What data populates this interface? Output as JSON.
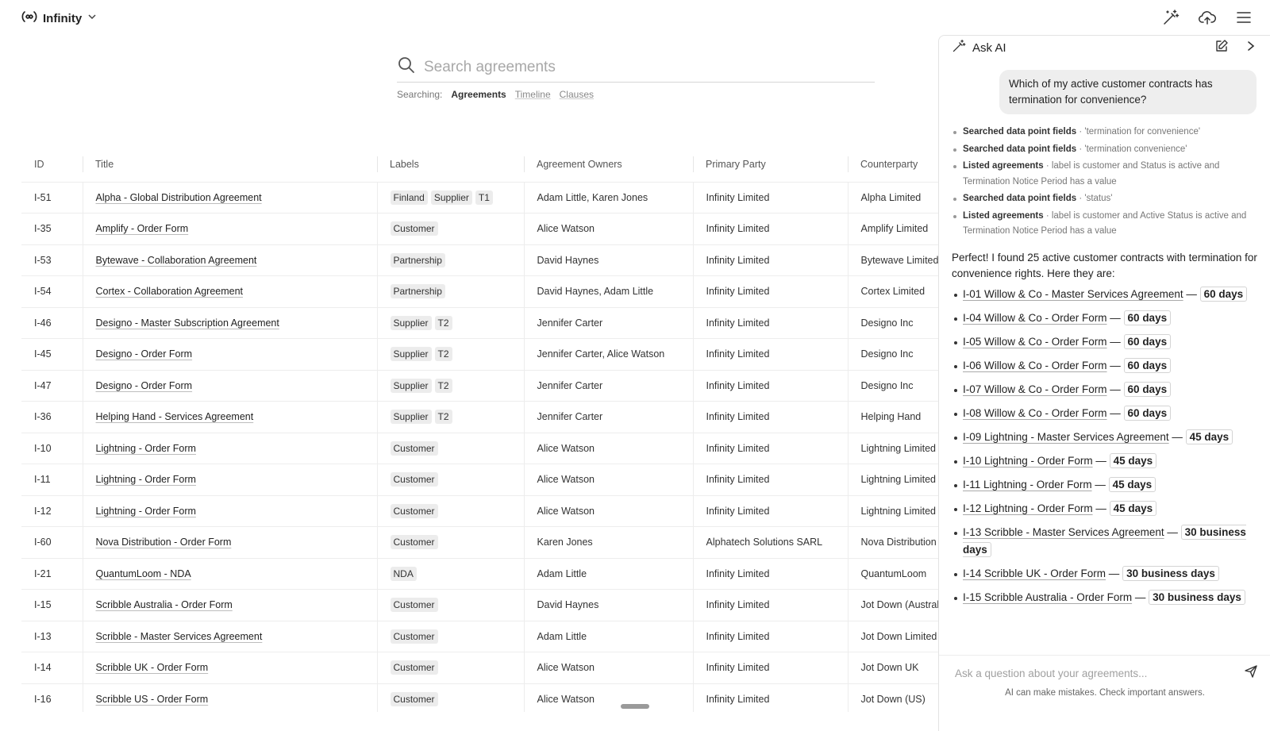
{
  "app": {
    "name": "Infinity"
  },
  "search": {
    "placeholder": "Search agreements",
    "searching_label": "Searching:",
    "scopes": [
      "Agreements",
      "Timeline",
      "Clauses"
    ]
  },
  "table": {
    "columns": [
      "ID",
      "Title",
      "Labels",
      "Agreement Owners",
      "Primary Party",
      "Counterparty"
    ],
    "rows": [
      {
        "id": "I-51",
        "title": "Alpha - Global Distribution Agreement",
        "labels": [
          "Finland",
          "Supplier",
          "T1"
        ],
        "owners": "Adam Little, Karen Jones",
        "primary": "Infinity Limited",
        "counterparty": "Alpha Limited"
      },
      {
        "id": "I-35",
        "title": "Amplify - Order Form",
        "labels": [
          "Customer"
        ],
        "owners": "Alice Watson",
        "primary": "Infinity Limited",
        "counterparty": "Amplify Limited"
      },
      {
        "id": "I-53",
        "title": "Bytewave - Collaboration Agreement",
        "labels": [
          "Partnership"
        ],
        "owners": "David Haynes",
        "primary": "Infinity Limited",
        "counterparty": "Bytewave Limited"
      },
      {
        "id": "I-54",
        "title": "Cortex - Collaboration Agreement",
        "labels": [
          "Partnership"
        ],
        "owners": "David Haynes, Adam Little",
        "primary": "Infinity Limited",
        "counterparty": "Cortex Limited"
      },
      {
        "id": "I-46",
        "title": "Designo - Master Subscription Agreement",
        "labels": [
          "Supplier",
          "T2"
        ],
        "owners": "Jennifer Carter",
        "primary": "Infinity Limited",
        "counterparty": "Designo Inc"
      },
      {
        "id": "I-45",
        "title": "Designo - Order Form",
        "labels": [
          "Supplier",
          "T2"
        ],
        "owners": "Jennifer Carter, Alice Watson",
        "primary": "Infinity Limited",
        "counterparty": "Designo Inc"
      },
      {
        "id": "I-47",
        "title": "Designo - Order Form",
        "labels": [
          "Supplier",
          "T2"
        ],
        "owners": "Jennifer Carter",
        "primary": "Infinity Limited",
        "counterparty": "Designo Inc"
      },
      {
        "id": "I-36",
        "title": "Helping Hand - Services Agreement",
        "labels": [
          "Supplier",
          "T2"
        ],
        "owners": "Jennifer Carter",
        "primary": "Infinity Limited",
        "counterparty": "Helping Hand"
      },
      {
        "id": "I-10",
        "title": "Lightning - Order Form",
        "labels": [
          "Customer"
        ],
        "owners": "Alice Watson",
        "primary": "Infinity Limited",
        "counterparty": "Lightning Limited"
      },
      {
        "id": "I-11",
        "title": "Lightning - Order Form",
        "labels": [
          "Customer"
        ],
        "owners": "Alice Watson",
        "primary": "Infinity Limited",
        "counterparty": "Lightning Limited"
      },
      {
        "id": "I-12",
        "title": "Lightning - Order Form",
        "labels": [
          "Customer"
        ],
        "owners": "Alice Watson",
        "primary": "Infinity Limited",
        "counterparty": "Lightning Limited"
      },
      {
        "id": "I-60",
        "title": "Nova Distribution - Order Form",
        "labels": [
          "Customer"
        ],
        "owners": "Karen Jones",
        "primary": "Alphatech Solutions SARL",
        "counterparty": "Nova Distribution"
      },
      {
        "id": "I-21",
        "title": "QuantumLoom - NDA",
        "labels": [
          "NDA"
        ],
        "owners": "Adam Little",
        "primary": "Infinity Limited",
        "counterparty": "QuantumLoom"
      },
      {
        "id": "I-15",
        "title": "Scribble Australia - Order Form",
        "labels": [
          "Customer"
        ],
        "owners": "David Haynes",
        "primary": "Infinity Limited",
        "counterparty": "Jot Down (Australia)"
      },
      {
        "id": "I-13",
        "title": "Scribble - Master Services Agreement",
        "labels": [
          "Customer"
        ],
        "owners": "Adam Little",
        "primary": "Infinity Limited",
        "counterparty": "Jot Down Limited"
      },
      {
        "id": "I-14",
        "title": "Scribble UK - Order Form",
        "labels": [
          "Customer"
        ],
        "owners": "Alice Watson",
        "primary": "Infinity Limited",
        "counterparty": "Jot Down UK"
      },
      {
        "id": "I-16",
        "title": "Scribble US - Order Form",
        "labels": [
          "Customer"
        ],
        "owners": "Alice Watson",
        "primary": "Infinity Limited",
        "counterparty": "Jot Down (US)"
      }
    ]
  },
  "ai": {
    "title": "Ask AI",
    "user_question": "Which of my active customer contracts has termination for convenience?",
    "steps": [
      {
        "action": "Searched data point fields",
        "detail": " · 'termination for convenience'"
      },
      {
        "action": "Searched data point fields",
        "detail": " · 'termination convenience'"
      },
      {
        "action": "Listed agreements",
        "detail": " · label is customer and Status is active and Termination Notice Period has a value"
      },
      {
        "action": "Searched data point fields",
        "detail": " · 'status'"
      },
      {
        "action": "Listed agreements",
        "detail": " · label is customer and Active Status is active and Termination Notice Period has a value"
      }
    ],
    "answer_intro": "Perfect! I found 25 active customer contracts with termination for convenience rights. Here they are:",
    "results": [
      {
        "name": "I-01 Willow & Co - Master Services Agreement",
        "value": "60 days"
      },
      {
        "name": "I-04 Willow & Co - Order Form",
        "value": "60 days"
      },
      {
        "name": "I-05 Willow & Co - Order Form",
        "value": "60 days"
      },
      {
        "name": "I-06 Willow & Co - Order Form",
        "value": "60 days"
      },
      {
        "name": "I-07 Willow & Co - Order Form",
        "value": "60 days"
      },
      {
        "name": "I-08 Willow & Co - Order Form",
        "value": "60 days"
      },
      {
        "name": "I-09 Lightning - Master Services Agreement",
        "value": "45 days"
      },
      {
        "name": "I-10 Lightning - Order Form",
        "value": "45 days"
      },
      {
        "name": "I-11 Lightning - Order Form",
        "value": "45 days"
      },
      {
        "name": "I-12 Lightning - Order Form",
        "value": "45 days"
      },
      {
        "name": "I-13 Scribble - Master Services Agreement",
        "value": "30 business days"
      },
      {
        "name": "I-14 Scribble UK - Order Form",
        "value": "30 business days"
      },
      {
        "name": "I-15 Scribble Australia - Order Form",
        "value": "30 business days"
      }
    ],
    "input_placeholder": "Ask a question about your agreements...",
    "disclaimer": "AI can make mistakes. Check important answers."
  },
  "icons": {
    "brand": "infinity-logo-icon",
    "dropdown": "chevron-down-icon",
    "magic": "magic-wand-icon",
    "upload": "cloud-upload-icon",
    "menu": "hamburger-menu-icon",
    "search": "search-icon",
    "edit": "edit-icon",
    "collapse": "chevron-right-icon",
    "send": "send-icon"
  }
}
